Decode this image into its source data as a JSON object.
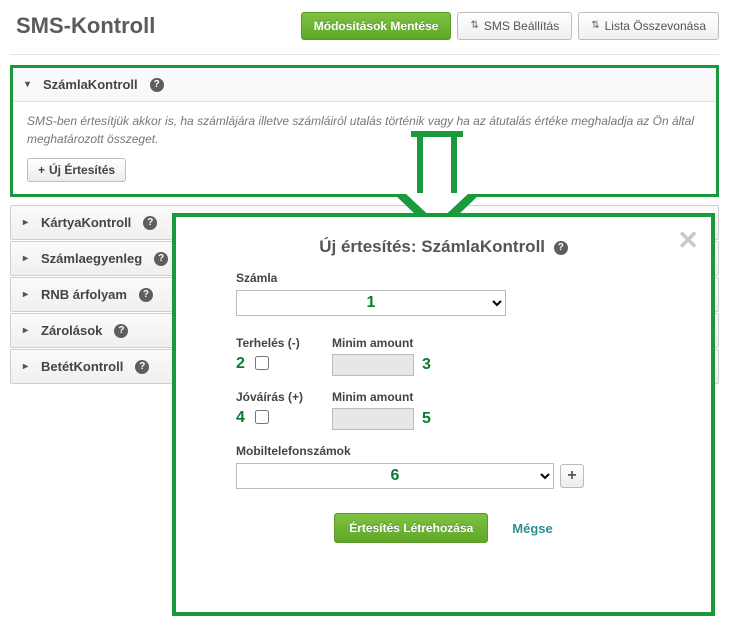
{
  "page": {
    "title": "SMS-Kontroll"
  },
  "topbar": {
    "save": "Módosítások Mentése",
    "settings": "SMS Beállítás",
    "merge": "Lista Összevonása"
  },
  "panels": {
    "szamla": {
      "title": "SzámlaKontroll",
      "desc": "SMS-ben értesítjük akkor is, ha számlájára illetve számláiról utalás történik vagy ha az átutalás értéke meghaladja az Ön által meghatározott összeget.",
      "new_btn": "Új Értesítés"
    },
    "kartya": "KártyaKontroll",
    "egyenleg": "Számlaegyenleg",
    "arfolyam": "RNB árfolyam",
    "zarolasok": "Zárolások",
    "betet": "BetétKontroll"
  },
  "modal": {
    "title": "Új értesítés: SzámlaKontroll",
    "account_label": "Számla",
    "debit_label": "Terhelés (-)",
    "credit_label": "Jóváírás (+)",
    "min_label": "Minim amount",
    "phones_label": "Mobiltelefonszámok",
    "create": "Értesítés Létrehozása",
    "cancel": "Mégse",
    "markers": {
      "m1": "1",
      "m2": "2",
      "m3": "3",
      "m4": "4",
      "m5": "5",
      "m6": "6"
    }
  },
  "icons": {
    "help": "?",
    "collapse": "▾",
    "expand": "▸",
    "updown": "⇅",
    "plus": "+",
    "close": "✕"
  }
}
